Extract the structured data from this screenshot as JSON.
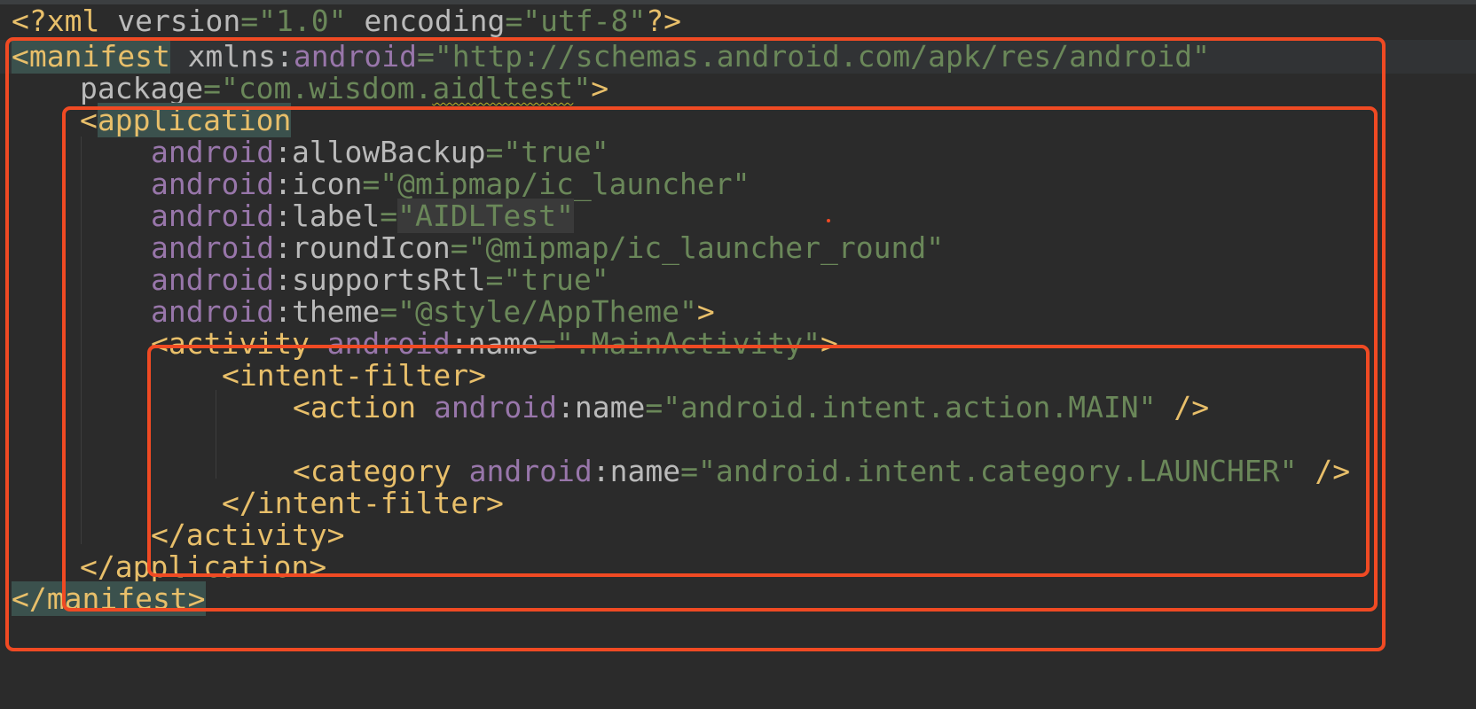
{
  "lines": [
    [
      "<?xml",
      " version",
      "=\"1.0\"",
      " encoding",
      "=\"utf-8\"",
      "?>"
    ],
    [
      "<manifest",
      " xmlns:",
      "android",
      "=\"http://schemas.android.com/apk/res/android\""
    ],
    [
      "package",
      "=\"com.wisdom.",
      "aidltest",
      "\"",
      ">"
    ],
    [
      "<",
      "application"
    ],
    [
      "android",
      ":allowBackup",
      "=\"true\""
    ],
    [
      "android",
      ":icon",
      "=\"@mipmap/ic_launcher\""
    ],
    [
      "android",
      ":label",
      "=",
      "\"AIDLTest\""
    ],
    [
      "android",
      ":roundIcon",
      "=\"@mipmap/ic_launcher_round\""
    ],
    [
      "android",
      ":supportsRtl",
      "=\"true\""
    ],
    [
      "android",
      ":theme",
      "=\"@style/AppTheme\"",
      ">"
    ],
    [
      "<activity",
      " android",
      ":name",
      "=\".MainActivity\"",
      ">"
    ],
    [
      "<intent-filter>"
    ],
    [
      "<action",
      " android",
      ":name",
      "=\"android.intent.action.MAIN\"",
      " />"
    ],
    [],
    [
      "<category",
      " android",
      ":name",
      "=\"android.intent.category.LAUNCHER\"",
      " />"
    ],
    [
      "</intent-filter>"
    ],
    [
      "</activity>"
    ],
    [
      "</application>"
    ],
    [
      "</manifest>"
    ]
  ],
  "colors": {
    "background": "#2b2b2b",
    "tag": "#e8bf6a",
    "namespace": "#9876aa",
    "attribute": "#bababa",
    "string": "#6a8759",
    "highlight_box": "#f04a23"
  }
}
